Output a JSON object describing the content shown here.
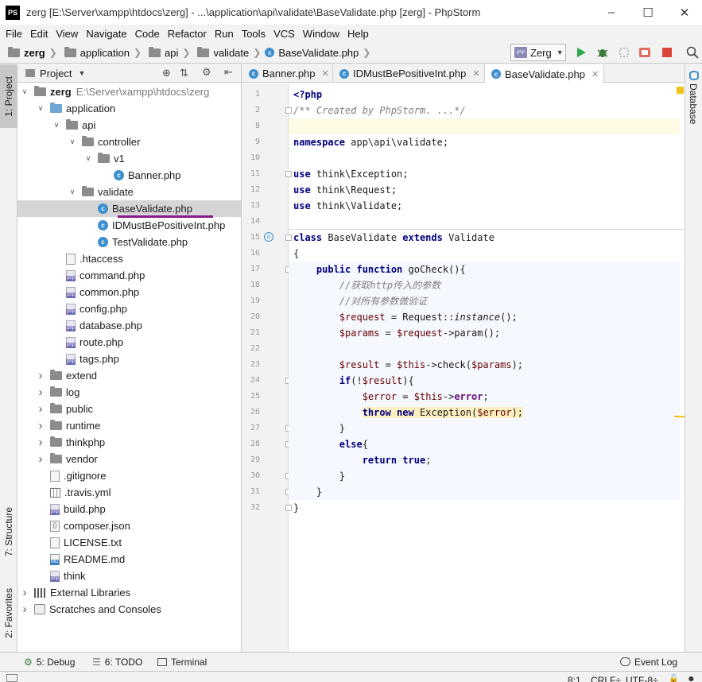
{
  "window": {
    "title": "zerg [E:\\Server\\xampp\\htdocs\\zerg] - ...\\application\\api\\validate\\BaseValidate.php [zerg] - PhpStorm",
    "app_logo": "PS",
    "controls": [
      "minimize-icon",
      "maximize-icon",
      "close-icon"
    ]
  },
  "menu": [
    "File",
    "Edit",
    "View",
    "Navigate",
    "Code",
    "Refactor",
    "Run",
    "Tools",
    "VCS",
    "Window",
    "Help"
  ],
  "breadcrumb": [
    "zerg",
    "application",
    "api",
    "validate",
    "BaseValidate.php"
  ],
  "run_config": {
    "label": "Zerg",
    "icon": "php-icon"
  },
  "toolbar_icons": [
    "run-icon",
    "debug-icon",
    "coverage-icon",
    "profile-icon",
    "stop-icon",
    "search-icon"
  ],
  "left_tabs": {
    "project": "1: Project",
    "structure": "7: Structure",
    "favorites": "2: Favorites"
  },
  "right_tabs": {
    "database": "Database"
  },
  "project_panel": {
    "title": "Project",
    "tree": [
      {
        "label": "zerg",
        "suffix": "E:\\Server\\xampp\\htdocs\\zerg",
        "icon": "folder",
        "depth": 0,
        "expanded": true,
        "bold": true
      },
      {
        "label": "application",
        "icon": "folder-blue",
        "depth": 1,
        "expanded": true
      },
      {
        "label": "api",
        "icon": "folder",
        "depth": 2,
        "expanded": true
      },
      {
        "label": "controller",
        "icon": "folder",
        "depth": 3,
        "expanded": true
      },
      {
        "label": "v1",
        "icon": "folder",
        "depth": 4,
        "expanded": true
      },
      {
        "label": "Banner.php",
        "icon": "class",
        "depth": 5
      },
      {
        "label": "validate",
        "icon": "folder",
        "depth": 3,
        "expanded": true
      },
      {
        "label": "BaseValidate.php",
        "icon": "class",
        "depth": 4,
        "selected": true
      },
      {
        "label": "IDMustBePositiveInt.php",
        "icon": "class",
        "depth": 4
      },
      {
        "label": "TestValidate.php",
        "icon": "class",
        "depth": 4
      },
      {
        "label": ".htaccess",
        "icon": "file",
        "depth": 2
      },
      {
        "label": "command.php",
        "icon": "php",
        "depth": 2
      },
      {
        "label": "common.php",
        "icon": "php",
        "depth": 2
      },
      {
        "label": "config.php",
        "icon": "php",
        "depth": 2
      },
      {
        "label": "database.php",
        "icon": "php",
        "depth": 2
      },
      {
        "label": "route.php",
        "icon": "php",
        "depth": 2
      },
      {
        "label": "tags.php",
        "icon": "php",
        "depth": 2
      },
      {
        "label": "extend",
        "icon": "folder",
        "depth": 1,
        "expanded": false
      },
      {
        "label": "log",
        "icon": "folder",
        "depth": 1,
        "expanded": false
      },
      {
        "label": "public",
        "icon": "folder",
        "depth": 1,
        "expanded": false
      },
      {
        "label": "runtime",
        "icon": "folder",
        "depth": 1,
        "expanded": false
      },
      {
        "label": "thinkphp",
        "icon": "folder",
        "depth": 1,
        "expanded": false
      },
      {
        "label": "vendor",
        "icon": "folder",
        "depth": 1,
        "expanded": false
      },
      {
        "label": ".gitignore",
        "icon": "file",
        "depth": 1
      },
      {
        "label": ".travis.yml",
        "icon": "grid",
        "depth": 1
      },
      {
        "label": "build.php",
        "icon": "php",
        "depth": 1
      },
      {
        "label": "composer.json",
        "icon": "json",
        "depth": 1
      },
      {
        "label": "LICENSE.txt",
        "icon": "file",
        "depth": 1
      },
      {
        "label": "README.md",
        "icon": "md",
        "depth": 1
      },
      {
        "label": "think",
        "icon": "php",
        "depth": 1
      },
      {
        "label": "External Libraries",
        "icon": "libs",
        "depth": 0,
        "expanded": false
      },
      {
        "label": "Scratches and Consoles",
        "icon": "scratch",
        "depth": 0,
        "expanded": false
      }
    ]
  },
  "editor": {
    "tabs": [
      {
        "label": "Banner.php",
        "active": false
      },
      {
        "label": "IDMustBePositiveInt.php",
        "active": false
      },
      {
        "label": "BaseValidate.php",
        "active": true
      }
    ],
    "lines": [
      {
        "n": "1",
        "html": "<span class=\"kw\">&lt;?php</span>"
      },
      {
        "n": "2",
        "html": "<span class=\"cm\">/** Created by PhpStorm. ...*/</span>"
      },
      {
        "n": "8",
        "html": "",
        "cur": true
      },
      {
        "n": "9",
        "html": "<span class=\"kw\">namespace</span> app\\api\\validate;"
      },
      {
        "n": "10",
        "html": ""
      },
      {
        "n": "11",
        "html": "<span class=\"kw\">use</span> think\\Exception;"
      },
      {
        "n": "12",
        "html": "<span class=\"kw\">use</span> think\\Request;"
      },
      {
        "n": "13",
        "html": "<span class=\"kw\">use</span> think\\Validate;"
      },
      {
        "n": "14",
        "html": ""
      },
      {
        "n": "15",
        "html": "<span class=\"kw\">class</span> BaseValidate <span class=\"kw\">extends</span> Validate"
      },
      {
        "n": "16",
        "html": "{"
      },
      {
        "n": "17",
        "html": "    <span class=\"kw\">public function</span> goCheck(){",
        "mbg": true
      },
      {
        "n": "18",
        "html": "        <span class=\"cm\">//获取http传入的参数</span>",
        "mbg": true
      },
      {
        "n": "19",
        "html": "        <span class=\"cm\">//对所有参数做验证</span>",
        "mbg": true
      },
      {
        "n": "20",
        "html": "        <span class=\"var\">$request</span> = Request::<span class=\"it\">instance</span>();",
        "mbg": true
      },
      {
        "n": "21",
        "html": "        <span class=\"var\">$params</span> = <span class=\"var\">$request</span>-&gt;param();",
        "mbg": true
      },
      {
        "n": "22",
        "html": "",
        "mbg": true
      },
      {
        "n": "23",
        "html": "        <span class=\"var\">$result</span> = <span class=\"var\">$this</span>-&gt;check(<span class=\"var\">$params</span>);",
        "mbg": true
      },
      {
        "n": "24",
        "html": "        <span class=\"kw\">if</span>(!<span class=\"var\">$result</span>){",
        "mbg": true
      },
      {
        "n": "25",
        "html": "            <span class=\"var\">$error</span> = <span class=\"var\">$this</span>-&gt;<span class=\"kw\" style=\"color:#660e7a\">error</span>;",
        "mbg": true
      },
      {
        "n": "26",
        "html": "            <span class=\"hl\"><span class=\"kw\">throw new</span> Exception(<span class=\"var\">$error</span>);</span>",
        "mbg": true
      },
      {
        "n": "27",
        "html": "        }",
        "mbg": true
      },
      {
        "n": "28",
        "html": "        <span class=\"kw\">else</span>{",
        "mbg": true
      },
      {
        "n": "29",
        "html": "            <span class=\"kw\">return true</span>;",
        "mbg": true
      },
      {
        "n": "30",
        "html": "        }",
        "mbg": true
      },
      {
        "n": "31",
        "html": "    }",
        "mbg": true
      },
      {
        "n": "32",
        "html": "}"
      }
    ]
  },
  "bottom_tools": {
    "debug": "5: Debug",
    "todo": "6: TODO",
    "terminal": "Terminal",
    "event_log": "Event Log"
  },
  "status": {
    "position": "8:1",
    "line_sep": "CRLF÷",
    "encoding": "UTF-8÷"
  },
  "colors": {
    "accent": "#3d8fce",
    "selection_underline": "#8b1a8b",
    "keyword": "#000080",
    "comment": "#808080",
    "variable": "#660000",
    "run_green": "#2fa84f",
    "stop_red": "#d9463a"
  }
}
